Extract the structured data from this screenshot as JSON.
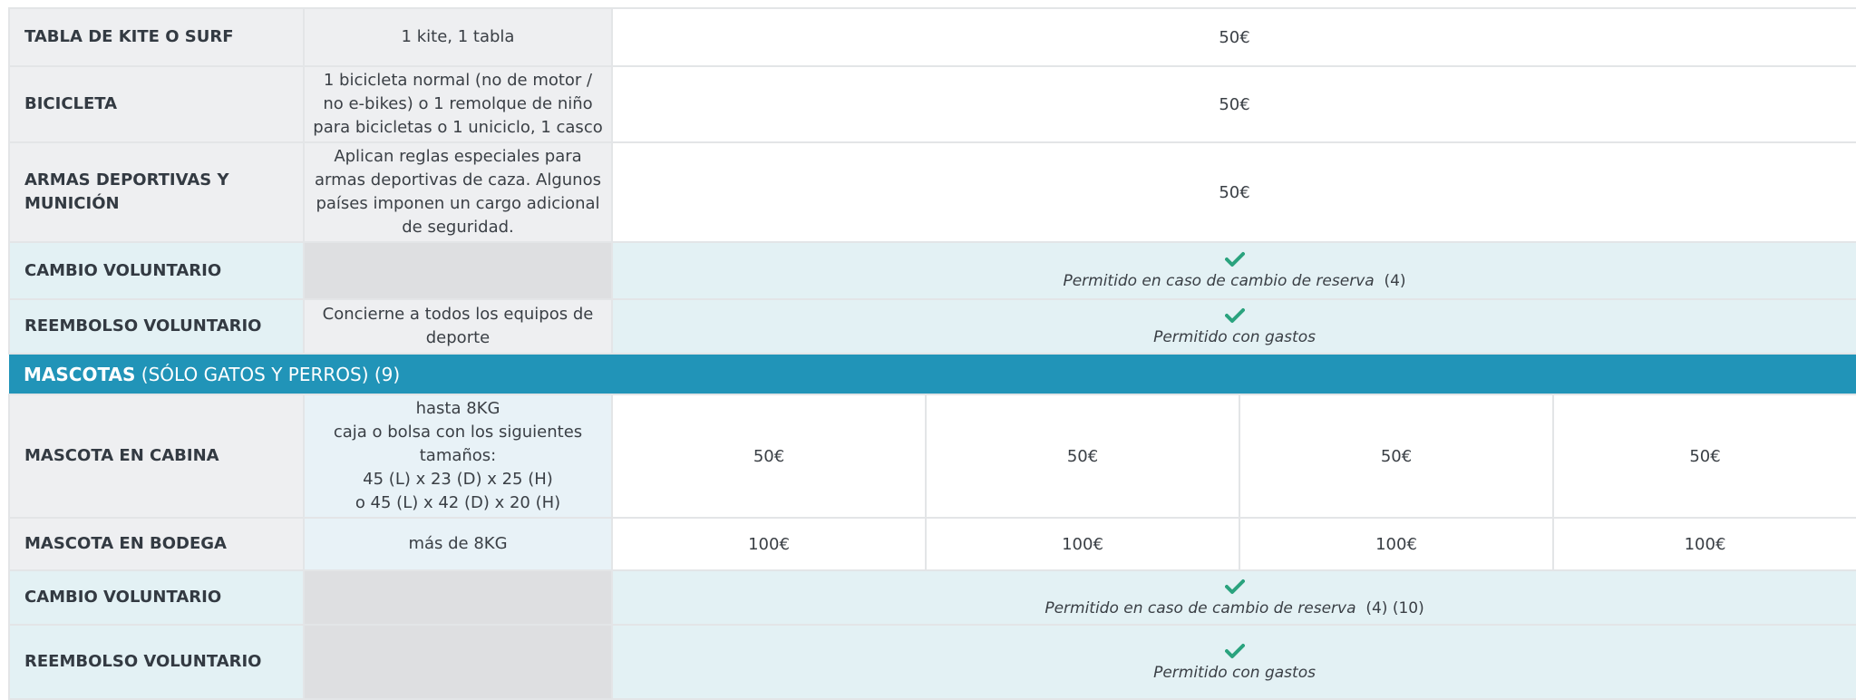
{
  "colors": {
    "section_bg": "#2194b8",
    "check": "#2aa37e",
    "cyan_row": "#e3f1f4"
  },
  "rows": {
    "kite": {
      "label": "TABLA DE KITE O SURF",
      "desc": "1 kite, 1 tabla",
      "price": "50€"
    },
    "bike": {
      "label": "BICICLETA",
      "desc": "1 bicicleta normal (no de motor / no e-bikes) o 1 remolque de niño para bicicletas o 1 uniciclo, 1 casco",
      "price": "50€"
    },
    "arms": {
      "label": "ARMAS DEPORTIVAS Y MUNICIÓN",
      "desc": "Aplican reglas especiales para armas deportivas de caza. Algunos países imponen un cargo adicional de seguridad.",
      "price": "50€"
    },
    "sport_change": {
      "label": "CAMBIO VOLUNTARIO",
      "icon": "check-icon",
      "note": "Permitido en caso de cambio de reserva",
      "refs": "(4)"
    },
    "sport_refund": {
      "label": "REEMBOLSO VOLUNTARIO",
      "desc": "Concierne a todos los equipos de deporte",
      "icon": "check-icon",
      "note": "Permitido con gastos"
    },
    "pets_section": {
      "title_strong": "MASCOTAS",
      "title_rest": " (SÓLO GATOS Y PERROS) (9)"
    },
    "pet_cabin": {
      "label": "MASCOTA EN CABINA",
      "desc_lines": [
        "hasta 8KG",
        "caja o bolsa con los siguientes tamaños:",
        "45 (L) x 23 (D) x 25 (H)",
        "o 45 (L) x 42 (D) x 20 (H)"
      ],
      "prices": [
        "50€",
        "50€",
        "50€",
        "50€"
      ]
    },
    "pet_hold": {
      "label": "MASCOTA EN BODEGA",
      "desc": "más de 8KG",
      "prices": [
        "100€",
        "100€",
        "100€",
        "100€"
      ]
    },
    "pet_change": {
      "label": "CAMBIO VOLUNTARIO",
      "icon": "check-icon",
      "note": "Permitido en caso de cambio de reserva",
      "refs": "(4) (10)"
    },
    "pet_refund": {
      "label": "REEMBOLSO VOLUNTARIO",
      "icon": "check-icon",
      "note": "Permitido con gastos"
    }
  }
}
